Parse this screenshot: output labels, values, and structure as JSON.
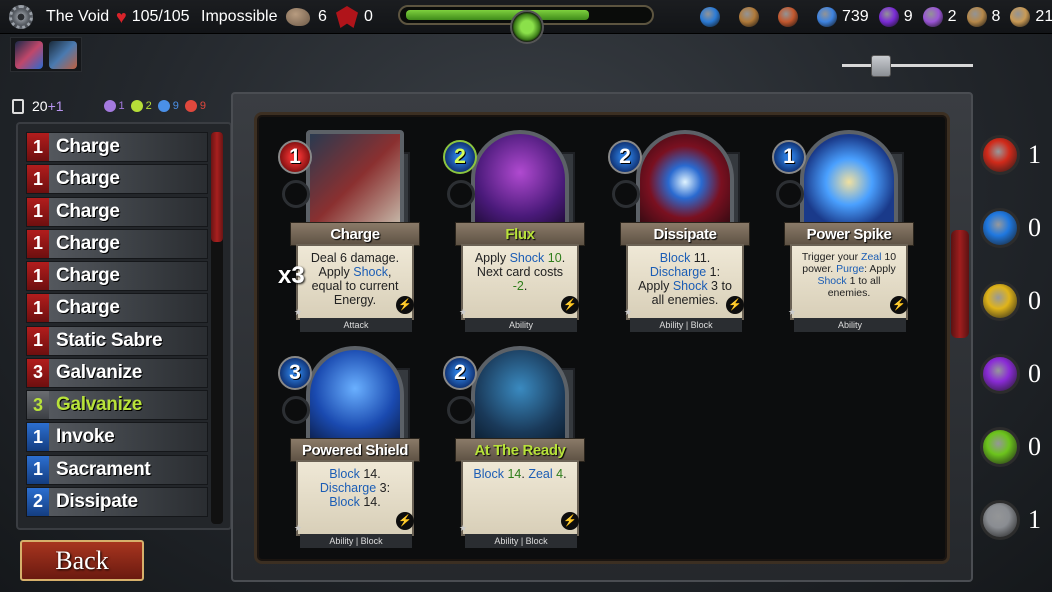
{
  "header": {
    "location": "The Void",
    "hp": "105/105",
    "difficulty": "Impossible",
    "rock_count": "6",
    "demon_count": "0",
    "hp_fraction": 0.75,
    "resources": [
      {
        "icon": "blue-gem-icon",
        "value": "",
        "color": "#2b7bd6"
      },
      {
        "icon": "satchel-icon",
        "value": "",
        "color": "#b07a3a"
      },
      {
        "icon": "scroll-icon",
        "value": "",
        "color": "#c3582e"
      },
      {
        "icon": "crystal-icon",
        "value": "739",
        "color": "#3e83e0"
      },
      {
        "icon": "purple-orb-icon",
        "value": "9",
        "color": "#7a2bd6"
      },
      {
        "icon": "potion-icon",
        "value": "2",
        "color": "#9a55d6"
      },
      {
        "icon": "treasure-icon",
        "value": "8",
        "color": "#b5884a"
      },
      {
        "icon": "map-icon",
        "value": "21",
        "color": "#c99a55"
      }
    ]
  },
  "deck": {
    "count": "20",
    "bonus": "+1",
    "stats": [
      {
        "icon": "skull-icon",
        "value": "1",
        "color": "#a47adf"
      },
      {
        "icon": "star-icon",
        "value": "2",
        "color": "#b6de38"
      },
      {
        "icon": "swirl-icon",
        "value": "9",
        "color": "#4a90e8"
      },
      {
        "icon": "sword-icon",
        "value": "9",
        "color": "#e0483d"
      }
    ],
    "rows": [
      {
        "cost": "1",
        "name": "Charge",
        "kind": "red"
      },
      {
        "cost": "1",
        "name": "Charge",
        "kind": "red"
      },
      {
        "cost": "1",
        "name": "Charge",
        "kind": "red"
      },
      {
        "cost": "1",
        "name": "Charge",
        "kind": "red"
      },
      {
        "cost": "1",
        "name": "Charge",
        "kind": "red"
      },
      {
        "cost": "1",
        "name": "Charge",
        "kind": "red"
      },
      {
        "cost": "1",
        "name": "Static Sabre",
        "kind": "red"
      },
      {
        "cost": "3",
        "name": "Galvanize",
        "kind": "red"
      },
      {
        "cost": "3",
        "name": "Galvanize",
        "kind": "upg"
      },
      {
        "cost": "1",
        "name": "Invoke",
        "kind": "blue"
      },
      {
        "cost": "1",
        "name": "Sacrament",
        "kind": "blue"
      },
      {
        "cost": "2",
        "name": "Dissipate",
        "kind": "blue"
      }
    ],
    "back_label": "Back"
  },
  "viewer": {
    "duplicate_label": "x3",
    "cards": [
      {
        "cost": "1",
        "title": "Charge",
        "type": "Attack",
        "orb": "red",
        "upgraded": false,
        "text": [
          {
            "t": "Deal 6 damage. Apply "
          },
          {
            "t": "Shock",
            "kw": true
          },
          {
            "t": ", equal to current Energy."
          }
        ]
      },
      {
        "cost": "2",
        "title": "Flux",
        "type": "Ability",
        "orb": "green",
        "upgraded": true,
        "text": [
          {
            "t": "Apply "
          },
          {
            "t": "Shock",
            "kw": true
          },
          {
            "t": " "
          },
          {
            "t": "10",
            "kwg": true
          },
          {
            "t": ". Next card costs "
          },
          {
            "t": "-2",
            "kwg": true
          },
          {
            "t": "."
          }
        ]
      },
      {
        "cost": "2",
        "title": "Dissipate",
        "type": "Ability | Block",
        "orb": "blue",
        "upgraded": false,
        "text": [
          {
            "t": "Block",
            "kw": true
          },
          {
            "t": " 11. "
          },
          {
            "t": "Discharge",
            "kw": true
          },
          {
            "t": " 1: Apply "
          },
          {
            "t": "Shock",
            "kw": true
          },
          {
            "t": " 3 to all enemies."
          }
        ]
      },
      {
        "cost": "1",
        "title": "Power Spike",
        "type": "Ability",
        "orb": "blue",
        "upgraded": false,
        "small": true,
        "text": [
          {
            "t": "Trigger your "
          },
          {
            "t": "Zeal",
            "kw": true
          },
          {
            "t": " 10 power. "
          },
          {
            "t": "Purge",
            "kw": true
          },
          {
            "t": ": Apply "
          },
          {
            "t": "Shock",
            "kw": true
          },
          {
            "t": " 1 to all enemies."
          }
        ]
      },
      {
        "cost": "3",
        "title": "Powered Shield",
        "type": "Ability | Block",
        "orb": "blue",
        "upgraded": false,
        "text": [
          {
            "t": "Block",
            "kw": true
          },
          {
            "t": " 14. "
          },
          {
            "t": "Discharge",
            "kw": true
          },
          {
            "t": " 3: "
          },
          {
            "t": "Block",
            "kw": true
          },
          {
            "t": " 14."
          }
        ]
      },
      {
        "cost": "2",
        "title": "At The Ready",
        "type": "Ability | Block",
        "orb": "blue",
        "upgraded": true,
        "text": [
          {
            "t": "Block",
            "kw": true
          },
          {
            "t": " "
          },
          {
            "t": "14",
            "kwg": true
          },
          {
            "t": ". "
          },
          {
            "t": "Zeal",
            "kw": true
          },
          {
            "t": " "
          },
          {
            "t": "4",
            "kwg": true
          },
          {
            "t": "."
          }
        ]
      }
    ]
  },
  "energy": [
    {
      "icon": "red-energy-icon",
      "value": "1",
      "color": "#d12a1a"
    },
    {
      "icon": "blue-energy-icon",
      "value": "0",
      "color": "#1f78e0"
    },
    {
      "icon": "yellow-energy-icon",
      "value": "0",
      "color": "#e0b41a"
    },
    {
      "icon": "purple-energy-icon",
      "value": "0",
      "color": "#8a2bd6"
    },
    {
      "icon": "green-energy-icon",
      "value": "0",
      "color": "#6cc41c"
    },
    {
      "icon": "grey-energy-icon",
      "value": "1",
      "color": "#8a8d92"
    }
  ]
}
